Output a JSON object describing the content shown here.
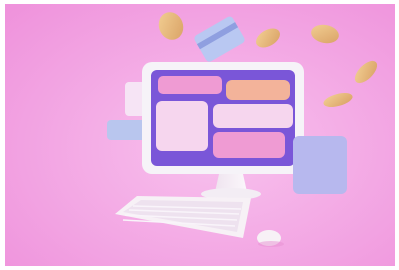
{
  "scene": {
    "subject": "computer-monitor-with-ui-cards",
    "colors": {
      "background": "#f4a6e6",
      "background_light": "#f8c2ee",
      "monitor_frame": "#f6f3f8",
      "screen": "#7a56d8",
      "card_pink": "#ef9bd3",
      "card_orange": "#f3b39a",
      "card_light": "#f6d6ee",
      "card_lavender": "#b7b8ee",
      "coin": "#e8b978",
      "keyboard": "#f7f1f6"
    }
  }
}
